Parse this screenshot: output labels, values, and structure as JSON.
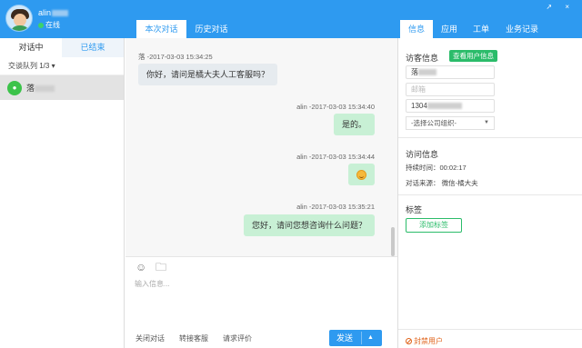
{
  "header": {
    "username": "alin",
    "status": "在线",
    "window_controls": "↗ ×",
    "chat_tabs": [
      "本次对话",
      "历史对话"
    ],
    "info_tabs": [
      "信息",
      "应用",
      "工单",
      "业务记录"
    ]
  },
  "left": {
    "tabs": [
      "对话中",
      "已结束"
    ],
    "queue": "交谈队列 1/3 ▾",
    "session_name": "落"
  },
  "messages": [
    {
      "meta": "落 -2017-03-03 15:34:25",
      "text": "你好，请问是橘大夫人工客服吗？",
      "dir": "in"
    },
    {
      "meta": "alin -2017-03-03 15:34:40",
      "text": "是的。",
      "dir": "out"
    },
    {
      "meta": "alin -2017-03-03 15:34:44",
      "text": "",
      "dir": "out",
      "emoji": "smile-emoji"
    },
    {
      "meta": "alin -2017-03-03 15:35:21",
      "text": "您好，请问您想咨询什么问题？",
      "dir": "out"
    }
  ],
  "composer": {
    "placeholder": "输入信息...",
    "actions": [
      "关闭对话",
      "转接客服",
      "请求评价"
    ],
    "send": "发送",
    "send_arrow": "▲"
  },
  "visitor": {
    "title": "访客信息",
    "view_btn": "查看用户信息",
    "name": "落",
    "note_placeholder": "邮箱",
    "phone": "1304",
    "company_select": "-选择公司组织-",
    "visit_title": "访问信息",
    "duration": "持续时间：00:02:17",
    "source": "对话来源：  微信-橘大夫",
    "tags_title": "标签",
    "add_tag": "添加标签",
    "ban": "封禁用户"
  },
  "colors": {
    "primary": "#2e9af0",
    "green": "#2bbc6a",
    "warn": "#e0641c"
  }
}
